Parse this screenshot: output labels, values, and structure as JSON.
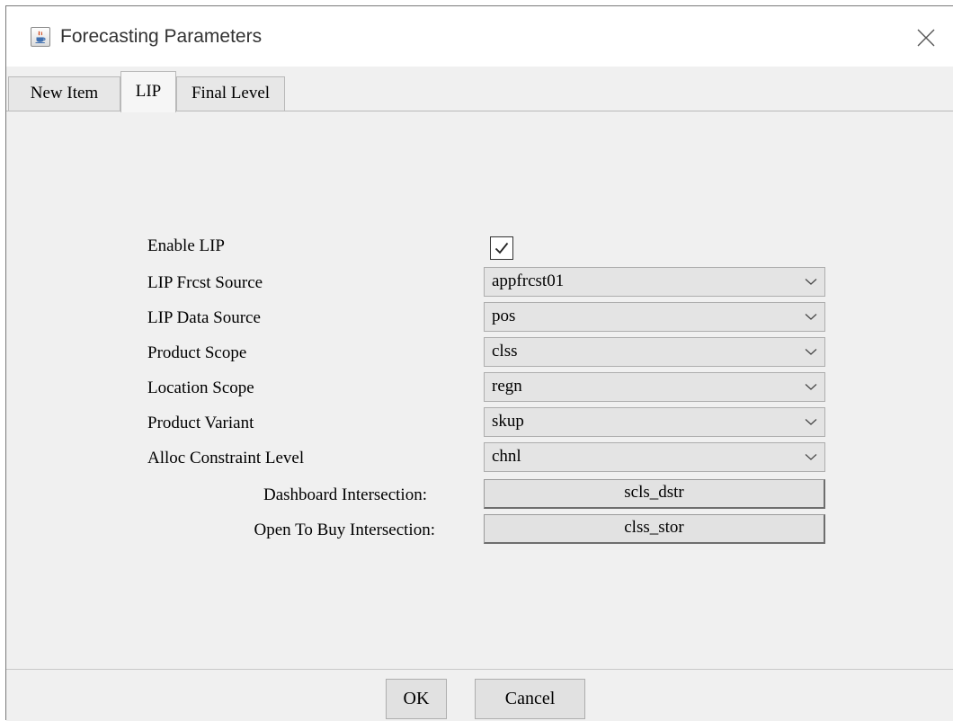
{
  "window": {
    "title": "Forecasting Parameters",
    "icon": "java-cup-icon",
    "close_icon": "close-icon"
  },
  "tabs": [
    {
      "label": "New Item",
      "active": false
    },
    {
      "label": "LIP",
      "active": true
    },
    {
      "label": "Final Level",
      "active": false
    }
  ],
  "form": {
    "enable_lip": {
      "label": "Enable LIP",
      "checked": true
    },
    "lip_frcst_source": {
      "label": "LIP Frcst Source",
      "value": "appfrcst01"
    },
    "lip_data_source": {
      "label": "LIP Data Source",
      "value": "pos"
    },
    "product_scope": {
      "label": "Product Scope",
      "value": "clss"
    },
    "location_scope": {
      "label": "Location Scope",
      "value": "regn"
    },
    "product_variant": {
      "label": "Product Variant",
      "value": "skup"
    },
    "alloc_constraint_level": {
      "label": "Alloc Constraint Level",
      "value": "chnl"
    },
    "dashboard_intersection": {
      "label": "Dashboard Intersection:",
      "value": "scls_dstr"
    },
    "open_to_buy_intersection": {
      "label": "Open To Buy Intersection:",
      "value": "clss_stor"
    }
  },
  "buttons": {
    "ok": "OK",
    "cancel": "Cancel"
  },
  "colors": {
    "window_bg": "#f0f0f0",
    "titlebar_bg": "#ffffff",
    "field_bg": "#e4e4e4",
    "border": "#adadad"
  }
}
